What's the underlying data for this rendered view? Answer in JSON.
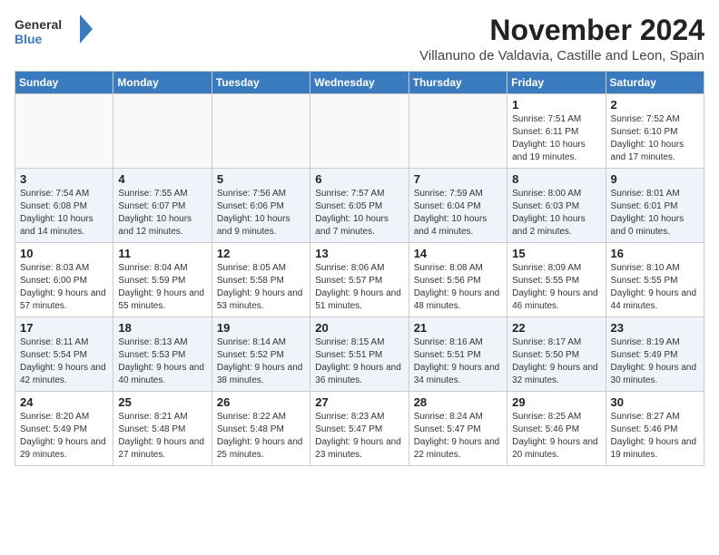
{
  "logo": {
    "general": "General",
    "blue": "Blue"
  },
  "title": "November 2024",
  "subtitle": "Villanuno de Valdavia, Castille and Leon, Spain",
  "days_of_week": [
    "Sunday",
    "Monday",
    "Tuesday",
    "Wednesday",
    "Thursday",
    "Friday",
    "Saturday"
  ],
  "weeks": [
    {
      "row_class": "row-odd",
      "days": [
        {
          "num": "",
          "info": "",
          "empty": true
        },
        {
          "num": "",
          "info": "",
          "empty": true
        },
        {
          "num": "",
          "info": "",
          "empty": true
        },
        {
          "num": "",
          "info": "",
          "empty": true
        },
        {
          "num": "",
          "info": "",
          "empty": true
        },
        {
          "num": "1",
          "info": "Sunrise: 7:51 AM\nSunset: 6:11 PM\nDaylight: 10 hours and 19 minutes."
        },
        {
          "num": "2",
          "info": "Sunrise: 7:52 AM\nSunset: 6:10 PM\nDaylight: 10 hours and 17 minutes."
        }
      ]
    },
    {
      "row_class": "row-even",
      "days": [
        {
          "num": "3",
          "info": "Sunrise: 7:54 AM\nSunset: 6:08 PM\nDaylight: 10 hours and 14 minutes."
        },
        {
          "num": "4",
          "info": "Sunrise: 7:55 AM\nSunset: 6:07 PM\nDaylight: 10 hours and 12 minutes."
        },
        {
          "num": "5",
          "info": "Sunrise: 7:56 AM\nSunset: 6:06 PM\nDaylight: 10 hours and 9 minutes."
        },
        {
          "num": "6",
          "info": "Sunrise: 7:57 AM\nSunset: 6:05 PM\nDaylight: 10 hours and 7 minutes."
        },
        {
          "num": "7",
          "info": "Sunrise: 7:59 AM\nSunset: 6:04 PM\nDaylight: 10 hours and 4 minutes."
        },
        {
          "num": "8",
          "info": "Sunrise: 8:00 AM\nSunset: 6:03 PM\nDaylight: 10 hours and 2 minutes."
        },
        {
          "num": "9",
          "info": "Sunrise: 8:01 AM\nSunset: 6:01 PM\nDaylight: 10 hours and 0 minutes."
        }
      ]
    },
    {
      "row_class": "row-odd",
      "days": [
        {
          "num": "10",
          "info": "Sunrise: 8:03 AM\nSunset: 6:00 PM\nDaylight: 9 hours and 57 minutes."
        },
        {
          "num": "11",
          "info": "Sunrise: 8:04 AM\nSunset: 5:59 PM\nDaylight: 9 hours and 55 minutes."
        },
        {
          "num": "12",
          "info": "Sunrise: 8:05 AM\nSunset: 5:58 PM\nDaylight: 9 hours and 53 minutes."
        },
        {
          "num": "13",
          "info": "Sunrise: 8:06 AM\nSunset: 5:57 PM\nDaylight: 9 hours and 51 minutes."
        },
        {
          "num": "14",
          "info": "Sunrise: 8:08 AM\nSunset: 5:56 PM\nDaylight: 9 hours and 48 minutes."
        },
        {
          "num": "15",
          "info": "Sunrise: 8:09 AM\nSunset: 5:55 PM\nDaylight: 9 hours and 46 minutes."
        },
        {
          "num": "16",
          "info": "Sunrise: 8:10 AM\nSunset: 5:55 PM\nDaylight: 9 hours and 44 minutes."
        }
      ]
    },
    {
      "row_class": "row-even",
      "days": [
        {
          "num": "17",
          "info": "Sunrise: 8:11 AM\nSunset: 5:54 PM\nDaylight: 9 hours and 42 minutes."
        },
        {
          "num": "18",
          "info": "Sunrise: 8:13 AM\nSunset: 5:53 PM\nDaylight: 9 hours and 40 minutes."
        },
        {
          "num": "19",
          "info": "Sunrise: 8:14 AM\nSunset: 5:52 PM\nDaylight: 9 hours and 38 minutes."
        },
        {
          "num": "20",
          "info": "Sunrise: 8:15 AM\nSunset: 5:51 PM\nDaylight: 9 hours and 36 minutes."
        },
        {
          "num": "21",
          "info": "Sunrise: 8:16 AM\nSunset: 5:51 PM\nDaylight: 9 hours and 34 minutes."
        },
        {
          "num": "22",
          "info": "Sunrise: 8:17 AM\nSunset: 5:50 PM\nDaylight: 9 hours and 32 minutes."
        },
        {
          "num": "23",
          "info": "Sunrise: 8:19 AM\nSunset: 5:49 PM\nDaylight: 9 hours and 30 minutes."
        }
      ]
    },
    {
      "row_class": "row-odd",
      "days": [
        {
          "num": "24",
          "info": "Sunrise: 8:20 AM\nSunset: 5:49 PM\nDaylight: 9 hours and 29 minutes."
        },
        {
          "num": "25",
          "info": "Sunrise: 8:21 AM\nSunset: 5:48 PM\nDaylight: 9 hours and 27 minutes."
        },
        {
          "num": "26",
          "info": "Sunrise: 8:22 AM\nSunset: 5:48 PM\nDaylight: 9 hours and 25 minutes."
        },
        {
          "num": "27",
          "info": "Sunrise: 8:23 AM\nSunset: 5:47 PM\nDaylight: 9 hours and 23 minutes."
        },
        {
          "num": "28",
          "info": "Sunrise: 8:24 AM\nSunset: 5:47 PM\nDaylight: 9 hours and 22 minutes."
        },
        {
          "num": "29",
          "info": "Sunrise: 8:25 AM\nSunset: 5:46 PM\nDaylight: 9 hours and 20 minutes."
        },
        {
          "num": "30",
          "info": "Sunrise: 8:27 AM\nSunset: 5:46 PM\nDaylight: 9 hours and 19 minutes."
        }
      ]
    }
  ]
}
